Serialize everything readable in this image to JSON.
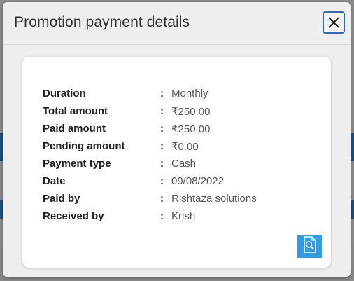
{
  "dialog": {
    "title": "Promotion payment details"
  },
  "details": [
    {
      "label": "Duration",
      "value": "Monthly"
    },
    {
      "label": "Total amount",
      "value": "₹250.00"
    },
    {
      "label": "Paid amount",
      "value": "₹250.00"
    },
    {
      "label": "Pending amount",
      "value": "₹0.00"
    },
    {
      "label": "Payment type",
      "value": "Cash"
    },
    {
      "label": "Date",
      "value": "09/08/2022"
    },
    {
      "label": "Paid by",
      "value": "Rishtaza solutions"
    },
    {
      "label": "Received by",
      "value": "Krish"
    }
  ],
  "separator": ":",
  "icons": {
    "close": "close-icon",
    "view": "document-search-icon"
  },
  "colors": {
    "accent": "#2b6cc0",
    "view_button": "#2e9ce6"
  }
}
